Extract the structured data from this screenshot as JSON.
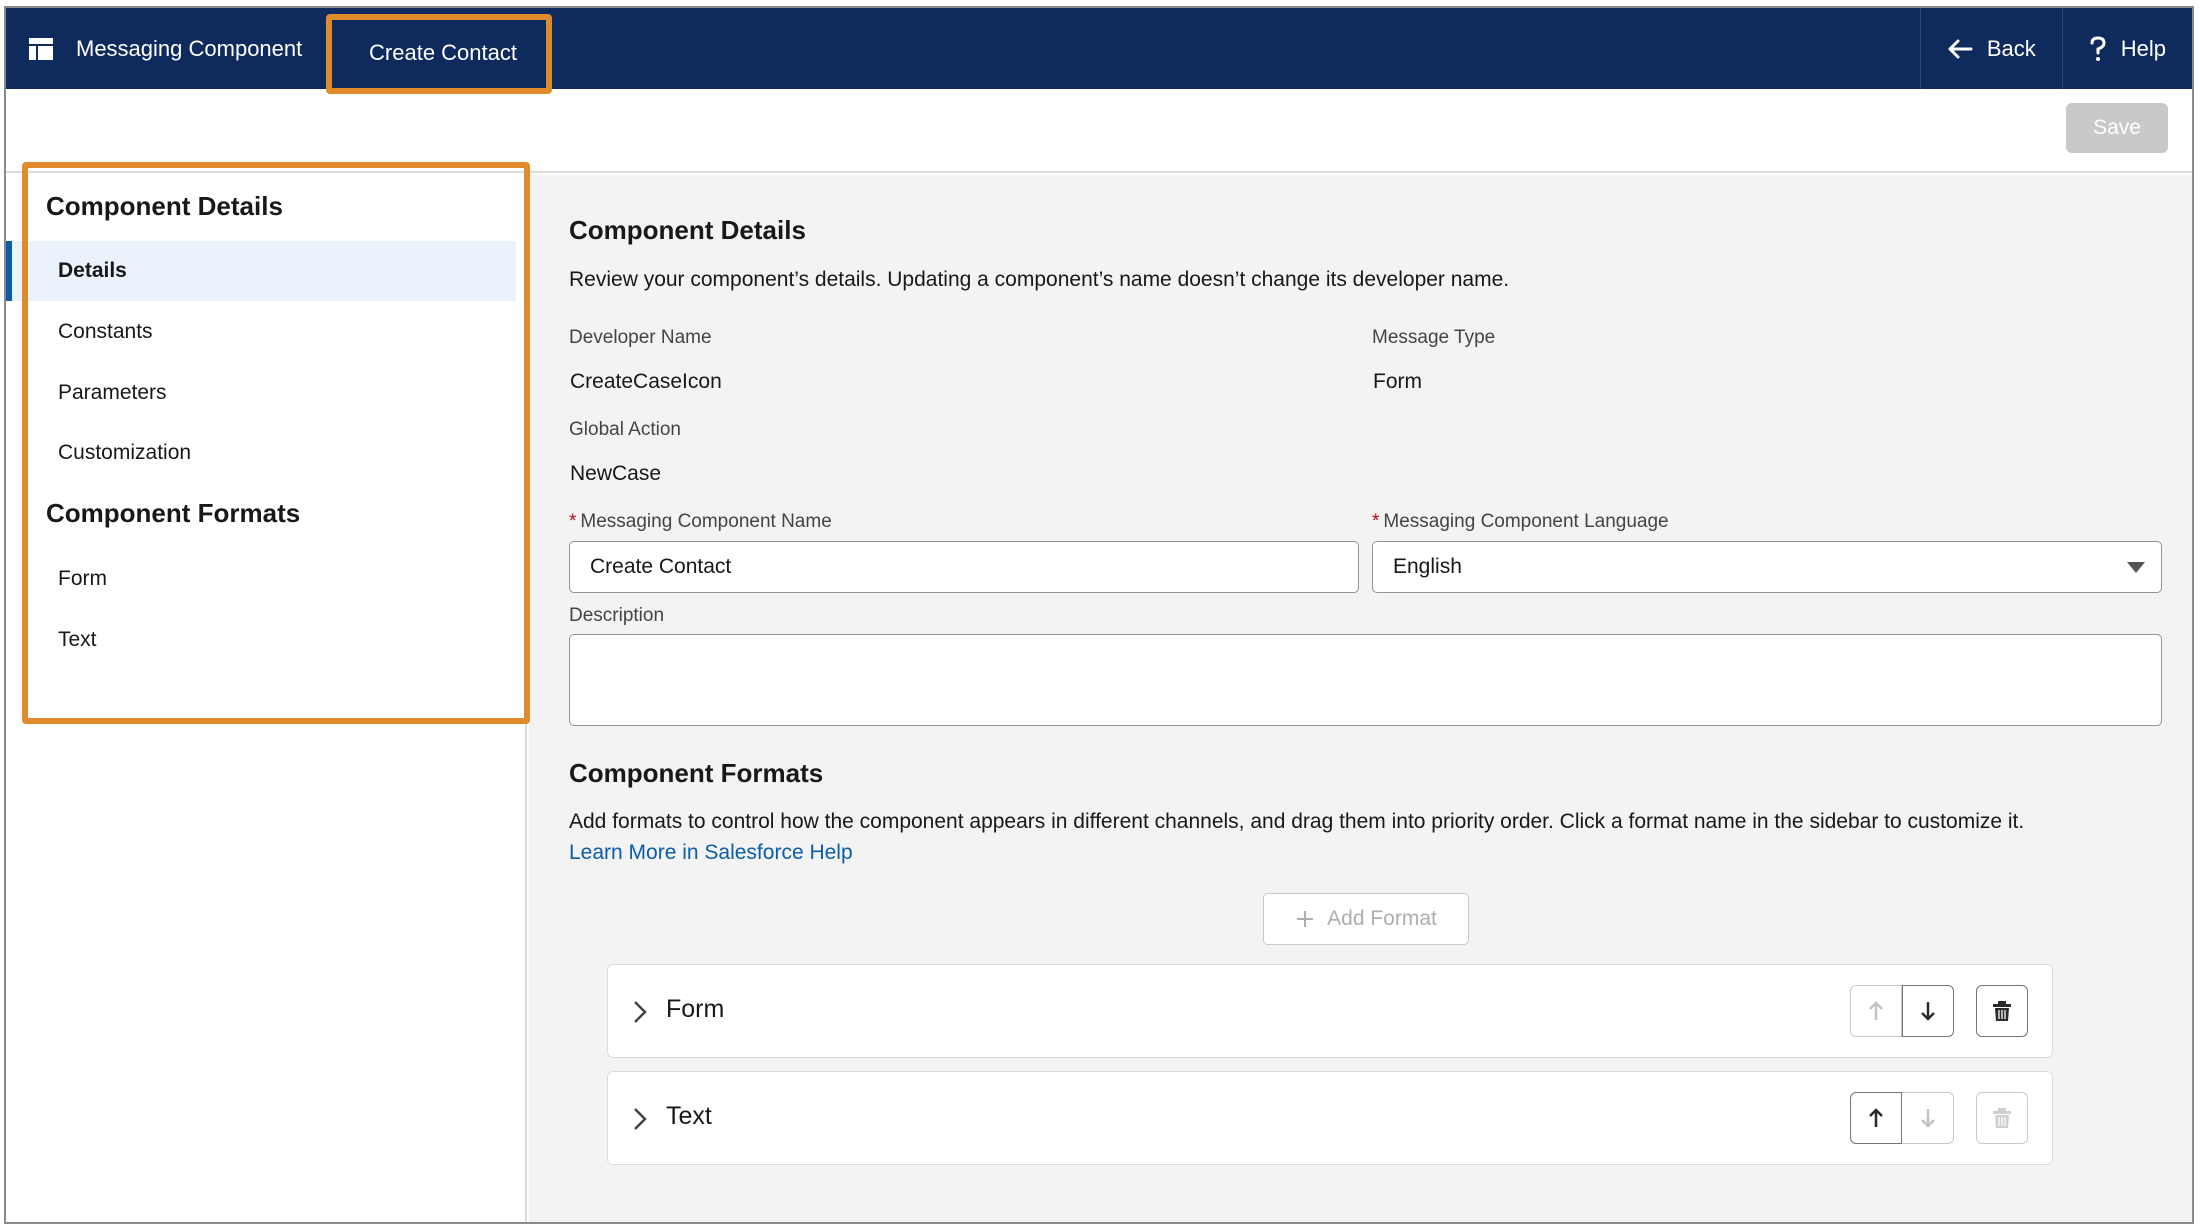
{
  "topbar": {
    "app_name": "Messaging Component",
    "active_tab": "Create Contact",
    "back_label": "Back",
    "help_label": "Help"
  },
  "toolbar": {
    "save_label": "Save"
  },
  "sidebar": {
    "details_heading": "Component Details",
    "details_items": [
      {
        "label": "Details",
        "active": true
      },
      {
        "label": "Constants"
      },
      {
        "label": "Parameters"
      },
      {
        "label": "Customization"
      }
    ],
    "formats_heading": "Component Formats",
    "format_items": [
      {
        "label": "Form"
      },
      {
        "label": "Text"
      }
    ]
  },
  "main": {
    "details_title": "Component Details",
    "details_description": "Review your component’s details. Updating a component’s name doesn’t change its developer name.",
    "developer_name_label": "Developer Name",
    "developer_name_value": "CreateCaseIcon",
    "message_type_label": "Message Type",
    "message_type_value": "Form",
    "global_action_label": "Global Action",
    "global_action_value": "NewCase",
    "required_marker": "*",
    "component_name_label": "Messaging Component Name",
    "component_name_value": "Create Contact",
    "language_label": "Messaging Component Language",
    "language_value": "English",
    "description_label": "Description",
    "description_value": "",
    "formats_title": "Component Formats",
    "formats_description": "Add formats to control how the component appears in different channels, and drag them into priority order. Click a format name in the sidebar to customize it.",
    "learn_more_link": "Learn More in Salesforce Help",
    "add_format_label": "Add Format",
    "formats": [
      {
        "name": "Form",
        "up_enabled": false,
        "down_enabled": true,
        "delete_enabled": true
      },
      {
        "name": "Text",
        "up_enabled": true,
        "down_enabled": false,
        "delete_enabled": false
      }
    ]
  },
  "colors": {
    "topbar": "#0f2a5c",
    "highlight": "#e08b2b",
    "link": "#0b5cab",
    "required": "#ba0517",
    "active_item_bg": "#eaf2fb"
  }
}
